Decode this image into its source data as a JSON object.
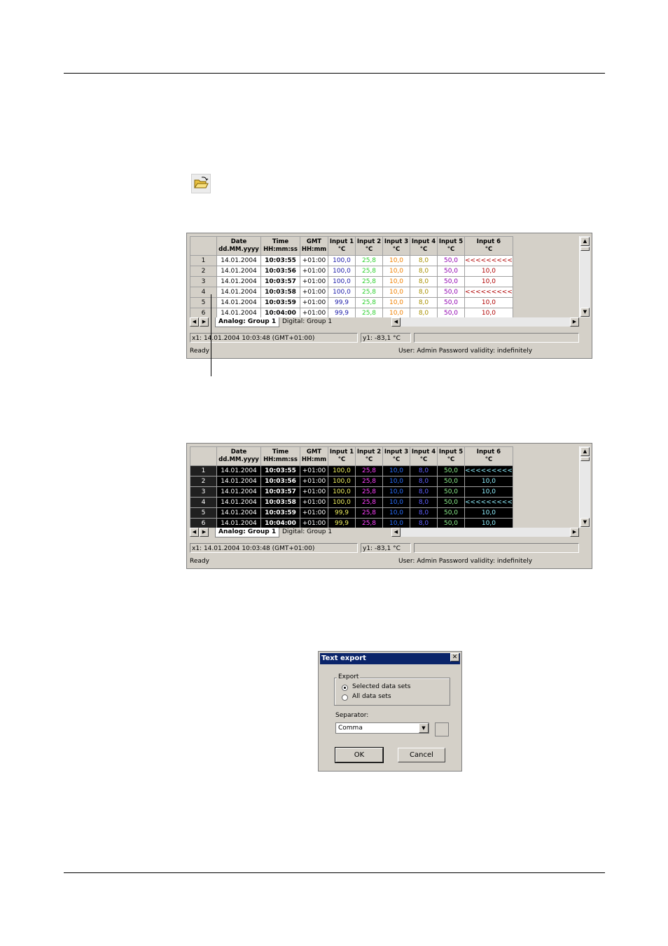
{
  "grid_headers": [
    {
      "l1": "Date",
      "l2": "dd.MM.yyyy"
    },
    {
      "l1": "Time",
      "l2": "HH:mm:ss"
    },
    {
      "l1": "GMT",
      "l2": "HH:mm"
    },
    {
      "l1": "Input 1",
      "l2": "°C"
    },
    {
      "l1": "Input 2",
      "l2": "°C"
    },
    {
      "l1": "Input 3",
      "l2": "°C"
    },
    {
      "l1": "Input 4",
      "l2": "°C"
    },
    {
      "l1": "Input 5",
      "l2": "°C"
    },
    {
      "l1": "Input 6",
      "l2": "°C"
    }
  ],
  "rows": [
    [
      "1",
      "14.01.2004",
      "10:03:55",
      "+01:00",
      "100,0",
      "25,8",
      "10,0",
      "8,0",
      "50,0",
      "<<<<<<<<<"
    ],
    [
      "2",
      "14.01.2004",
      "10:03:56",
      "+01:00",
      "100,0",
      "25,8",
      "10,0",
      "8,0",
      "50,0",
      "10,0"
    ],
    [
      "3",
      "14.01.2004",
      "10:03:57",
      "+01:00",
      "100,0",
      "25,8",
      "10,0",
      "8,0",
      "50,0",
      "10,0"
    ],
    [
      "4",
      "14.01.2004",
      "10:03:58",
      "+01:00",
      "100,0",
      "25,8",
      "10,0",
      "8,0",
      "50,0",
      "<<<<<<<<<"
    ],
    [
      "5",
      "14.01.2004",
      "10:03:59",
      "+01:00",
      "99,9",
      "25,8",
      "10,0",
      "8,0",
      "50,0",
      "10,0"
    ],
    [
      "6",
      "14.01.2004",
      "10:04:00",
      "+01:00",
      "99,9",
      "25,8",
      "10,0",
      "8,0",
      "50,0",
      "10,0"
    ]
  ],
  "tabs": {
    "analog": "Analog: Group 1",
    "digital": "Digital: Group 1"
  },
  "status": {
    "x1": "x1: 14.01.2004 10:03:48 (GMT+01:00)",
    "y1": "y1: -83,1 °C",
    "ready": "Ready",
    "user": "User: Admin   Password validity: indefinitely"
  },
  "dialog": {
    "title": "Text export",
    "close": "✕",
    "export_label": "Export",
    "opt_selected": "Selected data sets",
    "opt_all": "All data sets",
    "separator_label": "Separator:",
    "separator_value": "Comma",
    "ok": "OK",
    "cancel": "Cancel"
  },
  "icons": {
    "open": "folder-open-icon"
  }
}
